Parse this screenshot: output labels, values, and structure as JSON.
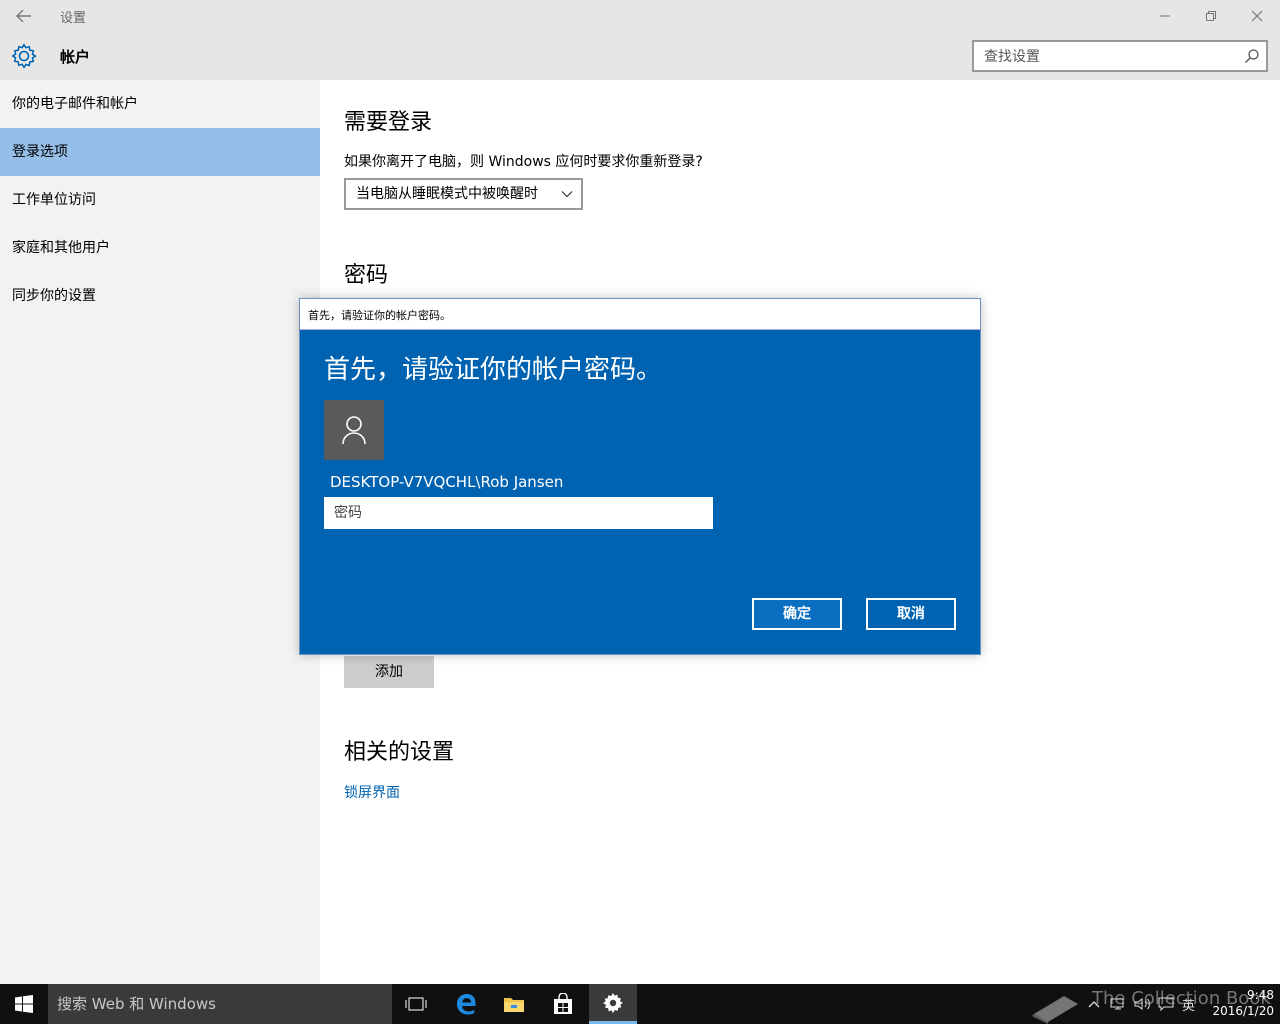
{
  "window": {
    "title": "设置",
    "icons": {
      "back": "back-arrow-icon",
      "minimize": "minimize-icon",
      "restore": "restore-icon",
      "close": "close-icon"
    }
  },
  "header": {
    "title": "帐户",
    "search_placeholder": "查找设置",
    "icon": "gear-icon"
  },
  "sidebar": {
    "items": [
      {
        "label": "你的电子邮件和帐户",
        "active": false
      },
      {
        "label": "登录选项",
        "active": true
      },
      {
        "label": "工作单位访问",
        "active": false
      },
      {
        "label": "家庭和其他用户",
        "active": false
      },
      {
        "label": "同步你的设置",
        "active": false
      }
    ]
  },
  "main": {
    "require_signin": {
      "heading": "需要登录",
      "question": "如果你离开了电脑，则 Windows 应何时要求你重新登录?",
      "dropdown_value": "当电脑从睡眠模式中被唤醒时"
    },
    "password": {
      "heading": "密码",
      "add_button": "添加"
    },
    "related": {
      "heading": "相关的设置",
      "link": "锁屏界面"
    }
  },
  "dialog": {
    "window_title": "首先，请验证你的帐户密码。",
    "heading": "首先，请验证你的帐户密码。",
    "username": "DESKTOP-V7VQCHL\\Rob Jansen",
    "password_placeholder": "密码",
    "ok_label": "确定",
    "cancel_label": "取消"
  },
  "taskbar": {
    "search_text": "搜索 Web 和 Windows",
    "apps": [
      "task-view-icon",
      "edge-icon",
      "file-explorer-icon",
      "store-icon",
      "settings-icon"
    ],
    "tray_lang": "英",
    "time": "9:48",
    "date": "2016/1/20",
    "watermark": "The Collection Book"
  },
  "colors": {
    "accent": "#0063b1",
    "sidebar_active": "#95bfe8",
    "chrome": "#e6e6e6",
    "sidebar_bg": "#f2f2f2",
    "taskbar": "#101010"
  }
}
